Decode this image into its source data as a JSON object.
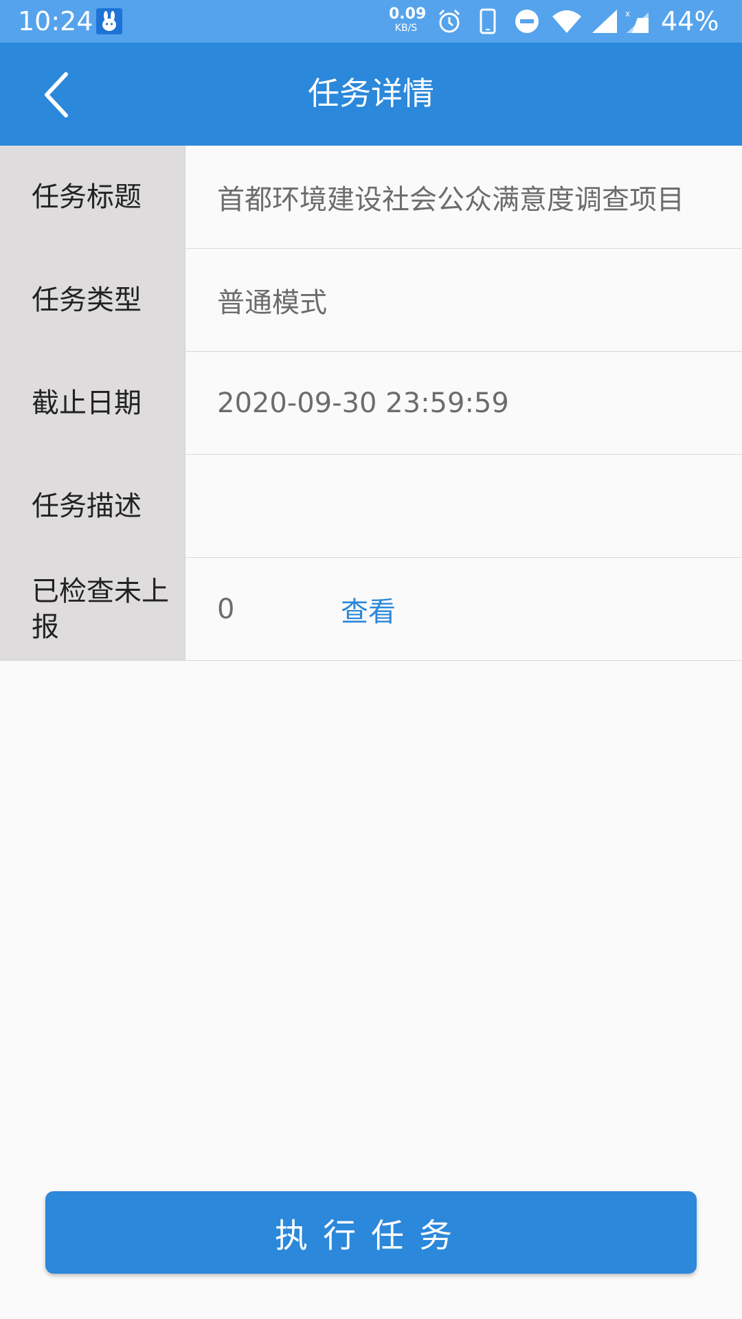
{
  "status_bar": {
    "time": "10:24",
    "net_speed_value": "0.09",
    "net_speed_unit": "KB/S",
    "battery": "44%",
    "icons": [
      "app-bunny-icon",
      "alarm-icon",
      "phone-icon",
      "dnd-icon",
      "wifi-icon",
      "signal-icon",
      "signal-x-icon"
    ]
  },
  "header": {
    "title": "任务详情",
    "back_icon": "chevron-left-icon"
  },
  "details": {
    "rows": [
      {
        "label": "任务标题",
        "value": "首都环境建设社会公众满意度调查项目"
      },
      {
        "label": "任务类型",
        "value": "普通模式"
      },
      {
        "label": "截止日期",
        "value": "2020-09-30 23:59:59"
      },
      {
        "label": "任务描述",
        "value": ""
      },
      {
        "label": "已检查未上报",
        "value": "0",
        "link": "查看"
      }
    ]
  },
  "actions": {
    "execute_label": "执行任务"
  },
  "colors": {
    "statusbar": "#55a3ec",
    "primary": "#2b88da",
    "label_bg": "#dedcdc",
    "background": "#fafafa"
  }
}
